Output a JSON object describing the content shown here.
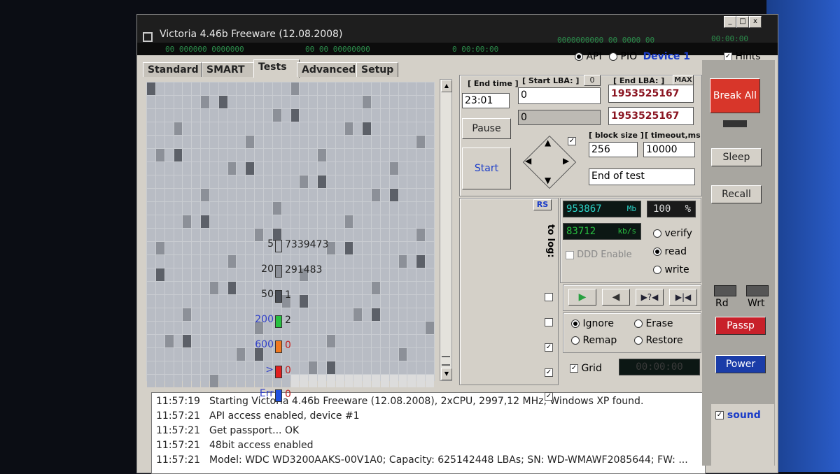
{
  "window": {
    "title": "Victoria 4.46b Freeware (12.08.2008)",
    "controls": [
      "_",
      "□",
      "x"
    ]
  },
  "statusbar": {
    "lcd1": "00  000000 0000000",
    "lcd2": "00  00  00000000",
    "lcd3": "0  00:00:00",
    "lcd4": "0000000000 00  0000 00",
    "lcd5": "00:00:00"
  },
  "device": {
    "api_label": "API",
    "pio_label": "PIO",
    "device_label": "Device 1",
    "hints_label": "Hints"
  },
  "tabs": [
    "Standard",
    "SMART",
    "Tests",
    "Advanced",
    "Setup"
  ],
  "controls": {
    "end_time_label": "[ End time ]",
    "end_time_value": "23:01",
    "start_lba_label": "[ Start LBA: ]",
    "start_lba_zero": "0",
    "start_lba_value": "0",
    "start_lba_current": "0",
    "end_lba_label": "[ End LBA: ]",
    "end_lba_max": "MAX",
    "end_lba_value": "1953525167",
    "end_lba_value2": "1953525167",
    "pause_label": "Pause",
    "start_label": "Start",
    "block_size_label": "[ block size ]",
    "block_size_value": "256",
    "timeout_label": "[ timeout,ms ]",
    "timeout_value": "10000",
    "end_action_value": "End of test"
  },
  "stats": {
    "rs_label": "RS",
    "to_log_label": "to log:",
    "rows": [
      {
        "label": "5",
        "value": "7339473",
        "color": "#b0b4bc"
      },
      {
        "label": "20",
        "value": "291483",
        "color": "#8c9098"
      },
      {
        "label": "50",
        "value": "1",
        "color": "#4a4e56"
      },
      {
        "label": "200",
        "value": "2",
        "color": "#28c040"
      },
      {
        "label": "600",
        "value": "0",
        "color": "#f07820"
      },
      {
        "label": ">",
        "value": "0",
        "color": "#e02020"
      },
      {
        "label": "Err",
        "value": "0",
        "color": "#2050e0"
      }
    ]
  },
  "progress": {
    "mb_value": "953867",
    "mb_unit": "Mb",
    "percent_value": "100",
    "percent_unit": "%",
    "speed_value": "83712",
    "speed_unit": "kb/s",
    "ddd_label": "DDD Enable",
    "verify_label": "verify",
    "read_label": "read",
    "write_label": "write"
  },
  "actions": {
    "ignore_label": "Ignore",
    "erase_label": "Erase",
    "remap_label": "Remap",
    "restore_label": "Restore",
    "grid_label": "Grid",
    "timer_value": "00:00:00"
  },
  "right_panel": {
    "break_all_label": "Break All",
    "sleep_label": "Sleep",
    "recall_label": "Recall",
    "rd_label": "Rd",
    "wrt_label": "Wrt",
    "passp_label": "Passp",
    "power_label": "Power",
    "sound_label": "sound"
  },
  "log": [
    {
      "time": "11:57:19",
      "text": "Starting Victoria 4.46b Freeware (12.08.2008), 2xCPU, 2997,12 MHz, Windows XP found."
    },
    {
      "time": "11:57:21",
      "text": "API access enabled, device #1"
    },
    {
      "time": "11:57:21",
      "text": "Get passport... OK"
    },
    {
      "time": "11:57:21",
      "text": "48bit access enabled"
    },
    {
      "time": "11:57:21",
      "text": "Model: WDC WD3200AAKS-00V1A0; Capacity: 625142448 LBAs; SN: WD-WMAWF2085644; FW: ..."
    }
  ]
}
